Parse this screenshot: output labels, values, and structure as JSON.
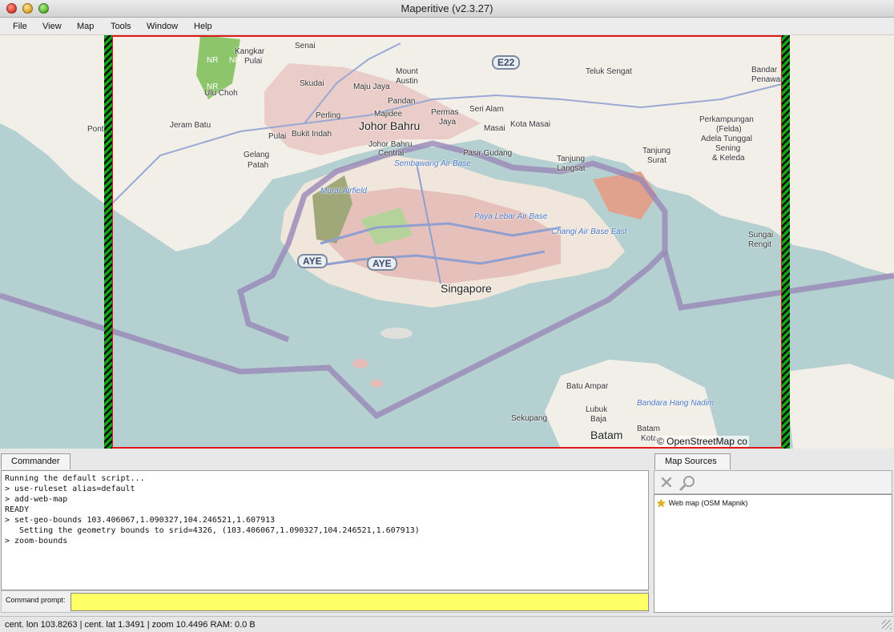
{
  "window": {
    "title": "Maperitive (v2.3.27)"
  },
  "menu": [
    "File",
    "View",
    "Map",
    "Tools",
    "Window",
    "Help"
  ],
  "map": {
    "labels": [
      {
        "text": "Senai",
        "cls": ""
      },
      {
        "text": "Kangkar",
        "cls": ""
      },
      {
        "text": "Pulai",
        "cls": ""
      },
      {
        "text": "Ulu Choh",
        "cls": ""
      },
      {
        "text": "Skudai",
        "cls": ""
      },
      {
        "text": "Maju Jaya",
        "cls": ""
      },
      {
        "text": "Mount",
        "cls": ""
      },
      {
        "text": "Austin",
        "cls": ""
      },
      {
        "text": "Pandan",
        "cls": ""
      },
      {
        "text": "Majidee",
        "cls": ""
      },
      {
        "text": "Permas",
        "cls": ""
      },
      {
        "text": "Jaya",
        "cls": ""
      },
      {
        "text": "Seri Alam",
        "cls": ""
      },
      {
        "text": "Teluk Sengat",
        "cls": ""
      },
      {
        "text": "Bandar",
        "cls": ""
      },
      {
        "text": "Penawar",
        "cls": ""
      },
      {
        "text": "Perling",
        "cls": ""
      },
      {
        "text": "Johor Bahru",
        "cls": "big"
      },
      {
        "text": "Masai",
        "cls": ""
      },
      {
        "text": "Kota Masai",
        "cls": ""
      },
      {
        "text": "Pont",
        "cls": ""
      },
      {
        "text": "Jeram Batu",
        "cls": ""
      },
      {
        "text": "Pulai",
        "cls": ""
      },
      {
        "text": "Bukit Indah",
        "cls": ""
      },
      {
        "text": "Johor Bahru",
        "cls": ""
      },
      {
        "text": "Central",
        "cls": ""
      },
      {
        "text": "Pasir Gudang",
        "cls": ""
      },
      {
        "text": "Perkampungan",
        "cls": ""
      },
      {
        "text": "(Felda)",
        "cls": ""
      },
      {
        "text": "Adela Tunggal",
        "cls": ""
      },
      {
        "text": "Sening",
        "cls": ""
      },
      {
        "text": "& Keleda",
        "cls": ""
      },
      {
        "text": "Gelang",
        "cls": ""
      },
      {
        "text": "Patah",
        "cls": ""
      },
      {
        "text": "Sembawang Air Base",
        "cls": "blue"
      },
      {
        "text": "Tanjung",
        "cls": ""
      },
      {
        "text": "Langsat",
        "cls": ""
      },
      {
        "text": "Tanjung",
        "cls": ""
      },
      {
        "text": "Surat",
        "cls": ""
      },
      {
        "text": "Murai Airfield",
        "cls": "blue"
      },
      {
        "text": "Paya Lebar Air Base",
        "cls": "blue"
      },
      {
        "text": "Changi Air Base East",
        "cls": "blue"
      },
      {
        "text": "Sungai",
        "cls": ""
      },
      {
        "text": "Rengit",
        "cls": ""
      },
      {
        "text": "Singapore",
        "cls": "big"
      },
      {
        "text": "Batu Ampar",
        "cls": ""
      },
      {
        "text": "Bandara Hang Nadim",
        "cls": "blue"
      },
      {
        "text": "Sekupang",
        "cls": ""
      },
      {
        "text": "Lubuk",
        "cls": ""
      },
      {
        "text": "Baja",
        "cls": ""
      },
      {
        "text": "Batam",
        "cls": "big"
      },
      {
        "text": "Batam",
        "cls": ""
      },
      {
        "text": "Kota",
        "cls": ""
      },
      {
        "text": "NR",
        "cls": ""
      },
      {
        "text": "NR",
        "cls": ""
      },
      {
        "text": "NR",
        "cls": ""
      }
    ],
    "shields": [
      "E22",
      "AYE",
      "AYE"
    ],
    "copyright": "© OpenStreetMap co"
  },
  "commander": {
    "tab": "Commander",
    "log": "Running the default script...\n> use-ruleset alias=default\n> add-web-map\nREADY\n> set-geo-bounds 103.406067,1.090327,104.246521,1.607913\n   Setting the geometry bounds to srid=4326, (103.406067,1.090327,104.246521,1.607913)\n> zoom-bounds",
    "prompt_label": "Command prompt:",
    "prompt_value": ""
  },
  "map_sources": {
    "tab": "Map Sources",
    "remove_icon": "close-icon",
    "zoom_icon": "magnifier-icon",
    "items": [
      {
        "icon": "star-icon",
        "label": "Web map (OSM Mapnik)"
      }
    ]
  },
  "status": {
    "text": "cent. lon 103.8263 | cent. lat 1.3491 | zoom 10.4496   RAM: 0.0 B"
  }
}
